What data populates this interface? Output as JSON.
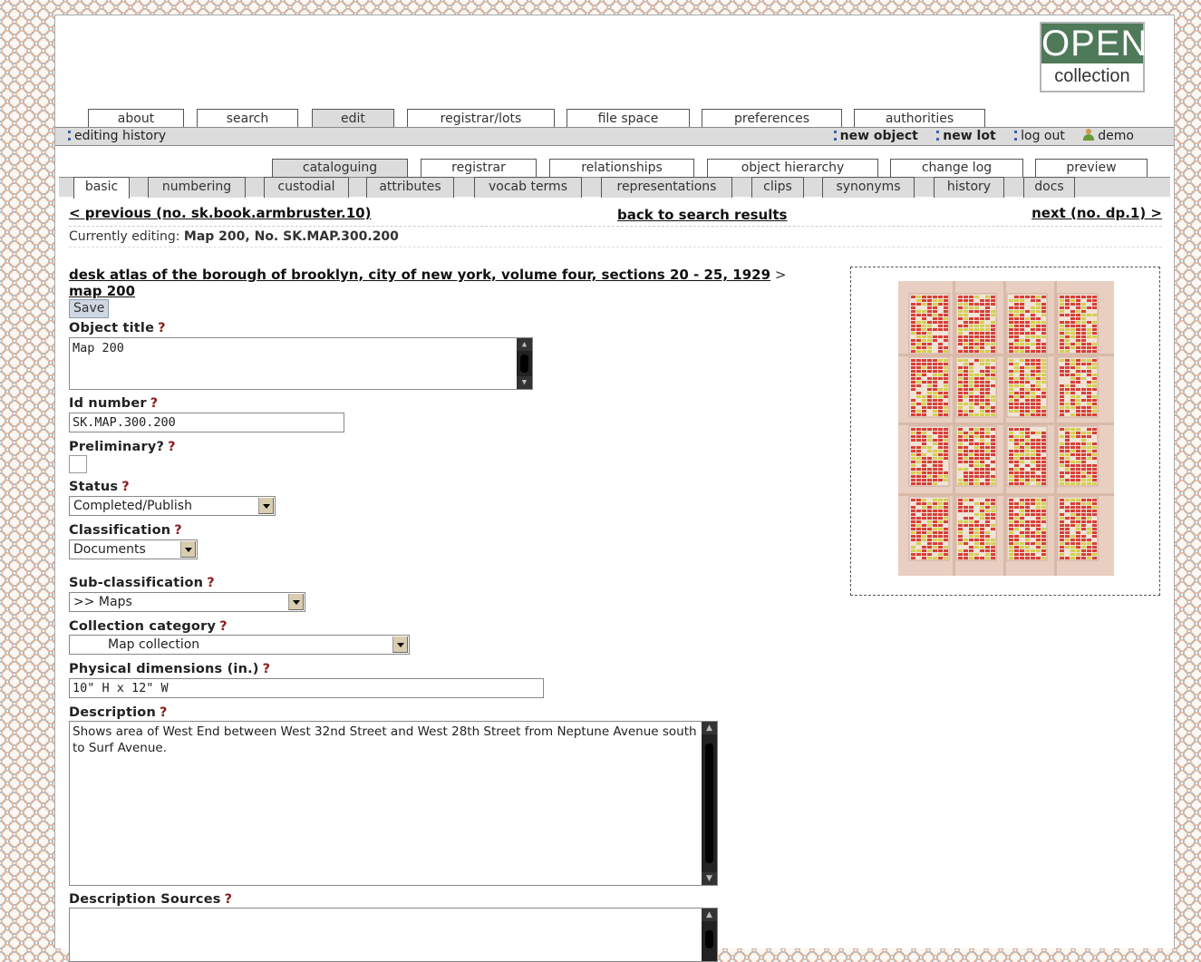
{
  "logo": {
    "line1": "OPEN",
    "line2": "collection"
  },
  "top_tabs": [
    {
      "label": "about"
    },
    {
      "label": "search"
    },
    {
      "label": "edit",
      "active": true
    },
    {
      "label": "registrar/lots"
    },
    {
      "label": "file space"
    },
    {
      "label": "preferences"
    },
    {
      "label": "authorities"
    }
  ],
  "topbar": {
    "editing_history": "editing history",
    "new_object": "new object",
    "new_lot": "new lot",
    "log_out": "log out",
    "user": "demo"
  },
  "section_tabs": [
    {
      "label": "cataloguing",
      "active": true
    },
    {
      "label": "registrar"
    },
    {
      "label": "relationships"
    },
    {
      "label": "object hierarchy"
    },
    {
      "label": "change log"
    },
    {
      "label": "preview"
    }
  ],
  "sub_tabs": [
    {
      "label": "basic",
      "active": true
    },
    {
      "label": "numbering"
    },
    {
      "label": "custodial"
    },
    {
      "label": "attributes"
    },
    {
      "label": "vocab terms"
    },
    {
      "label": "representations"
    },
    {
      "label": "clips"
    },
    {
      "label": "synonyms"
    },
    {
      "label": "history"
    },
    {
      "label": "docs"
    }
  ],
  "nav": {
    "previous": "< previous (no. sk.book.armbruster.10)",
    "back": "back to search results",
    "next": "next (no. dp.1) >"
  },
  "current": {
    "prefix": "Currently editing:",
    "value": "Map 200, No. SK.MAP.300.200"
  },
  "breadcrumb": {
    "parent": "desk atlas of the borough of brooklyn, city of new york, volume four, sections 20 - 25, 1929",
    "separator": ">",
    "current": "map 200"
  },
  "save_label": "Save",
  "help_mark": "?",
  "form": {
    "object_title": {
      "label": "Object title",
      "value": "Map 200"
    },
    "id_number": {
      "label": "Id number",
      "value": "SK.MAP.300.200"
    },
    "preliminary": {
      "label": "Preliminary?",
      "checked": false
    },
    "status": {
      "label": "Status",
      "value": "Completed/Publish"
    },
    "classification": {
      "label": "Classification",
      "value": "Documents"
    },
    "sub_classification": {
      "label": "Sub-classification",
      "value": ">> Maps"
    },
    "collection_category": {
      "label": "Collection category",
      "value": "Map collection"
    },
    "physical_dimensions": {
      "label": "Physical dimensions (in.)",
      "value": "10\" H x 12\" W"
    },
    "description": {
      "label": "Description",
      "value": "Shows area of West End between West 32nd Street and West 28th Street from Neptune Avenue south to Surf Avenue."
    },
    "description_sources": {
      "label": "Description Sources",
      "value": ""
    }
  },
  "colors": {
    "tab_active": "#dcdcdc",
    "logo_green": "#4f7a59",
    "help_mark": "#8b1a1a",
    "map_building_red": "#d8403a",
    "map_building_yellow": "#d4cf52",
    "map_paper": "#e6c9b7"
  }
}
